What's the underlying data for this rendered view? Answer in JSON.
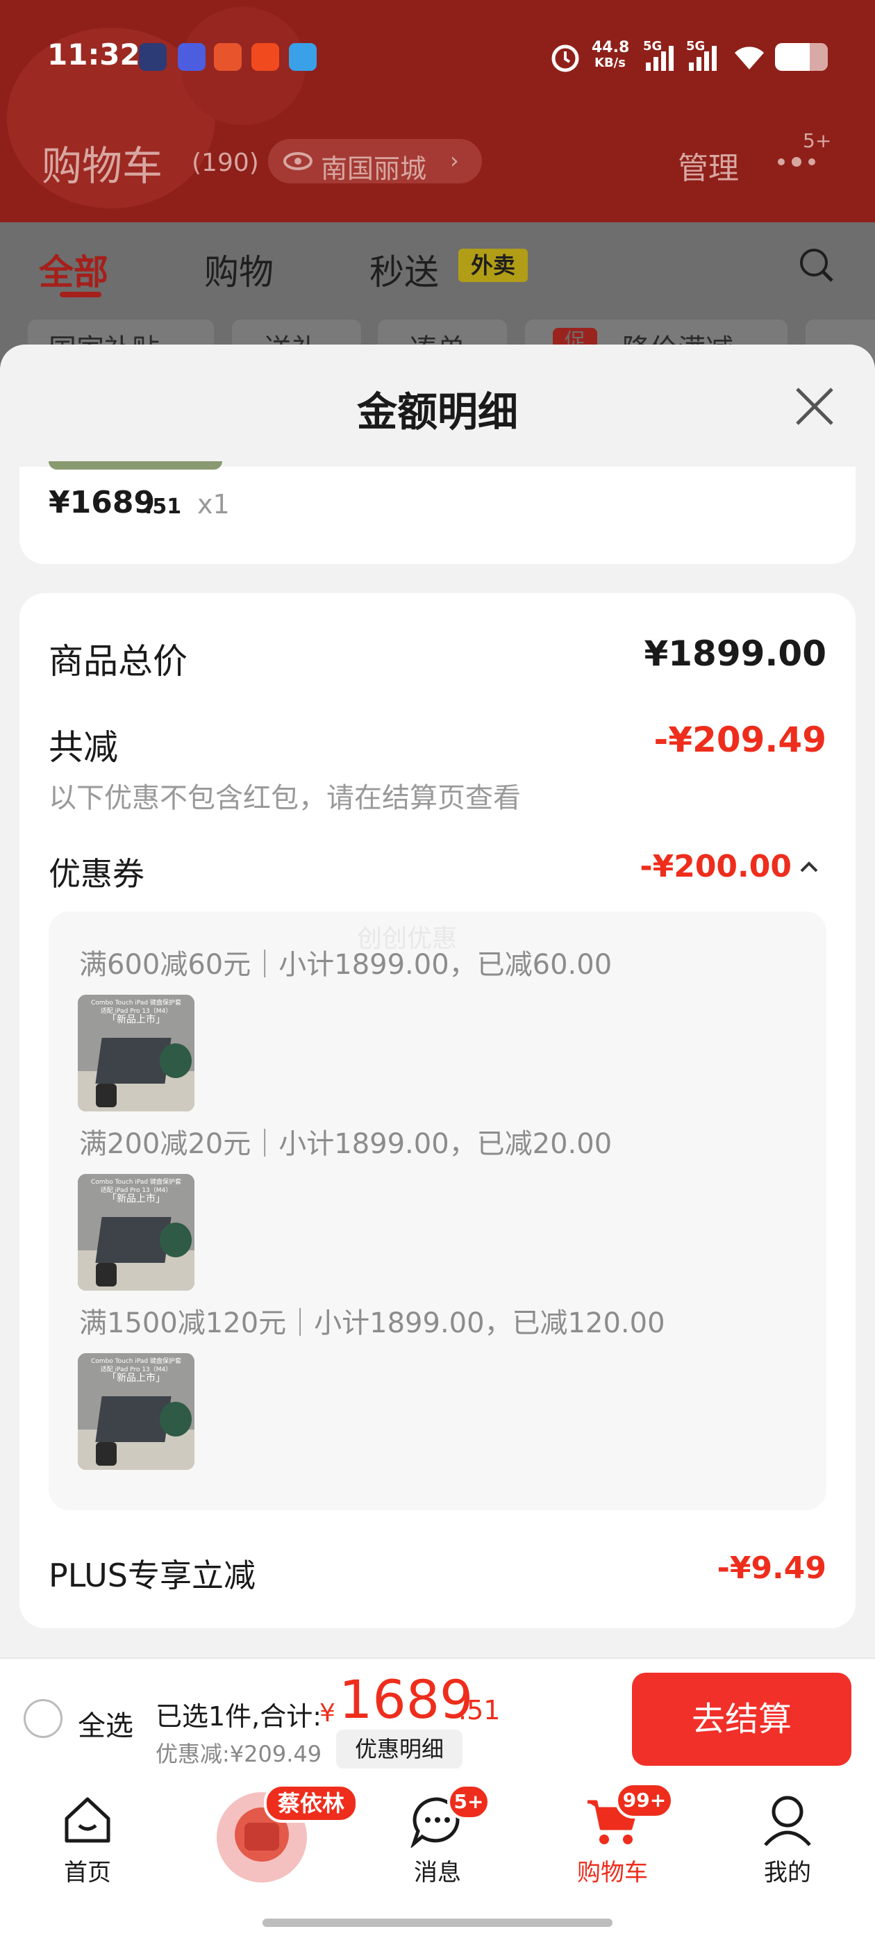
{
  "status_bar": {
    "time": "11:32",
    "net_speed": "44.8",
    "net_unit": "KB/s",
    "signal1": "5G",
    "signal2": "5G"
  },
  "header": {
    "title": "购物车",
    "count": "(190)",
    "location": "南国丽城",
    "manage": "管理",
    "more_badge": "5+"
  },
  "tabs": {
    "all": "全部",
    "shopping": "购物",
    "fast": "秒送",
    "waimai": "外卖"
  },
  "chips": [
    "国家补贴",
    "送礼",
    "凑单",
    "降价满减"
  ],
  "chip_badge": "促",
  "sheet": {
    "title": "金额明细",
    "item_price_main": "¥1689",
    "item_price_dec": ".51",
    "item_qty": "x1",
    "total_label": "商品总价",
    "total_value": "¥1899.00",
    "reduce_label": "共减",
    "reduce_value": "-¥209.49",
    "reduce_note": "以下优惠不包含红包，请在结算页查看",
    "coupon_label": "优惠券",
    "coupon_value": "-¥200.00",
    "watermark": "创创优惠",
    "coupons": [
      {
        "text": "满600减60元｜小计1899.00，已减60.00"
      },
      {
        "text": "满200减20元｜小计1899.00，已减20.00"
      },
      {
        "text": "满1500减120元｜小计1899.00，已减120.00"
      }
    ],
    "thumb_lines": [
      "Combo Touch iPad 键盘保护套",
      "适配 iPad Pro 13（M4）",
      "「新品上市」"
    ],
    "plus_label": "PLUS专享立减",
    "plus_value": "-¥9.49"
  },
  "bottom": {
    "select_all": "全选",
    "selected_text": "已选1件,合计:",
    "currency": "¥",
    "total_main": "1689",
    "total_dec": ".51",
    "discount_text": "优惠减:¥209.49",
    "detail_btn": "优惠明细",
    "checkout": "去结算"
  },
  "nav": {
    "home": "首页",
    "avatar_badge": "蔡依林",
    "messages": "消息",
    "messages_badge": "5+",
    "cart": "购物车",
    "cart_badge": "99+",
    "mine": "我的"
  },
  "colors": {
    "accent": "#ee2d1c",
    "header": "#8e1f19"
  }
}
